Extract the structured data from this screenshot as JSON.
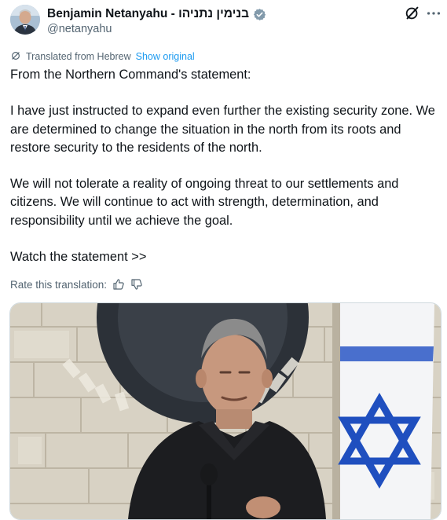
{
  "author": {
    "display_name": "Benjamin Netanyahu - בנימין נתניהו",
    "handle": "@netanyahu",
    "avatar_icon": "profile-photo",
    "verified_icon": "verified-badge-gray"
  },
  "header_actions": {
    "grok_icon": "grok-icon",
    "more_icon": "more-horizontal-icon"
  },
  "translation": {
    "notice": "Translated from Hebrew",
    "show_original": "Show original",
    "rate_label": "Rate this translation:"
  },
  "tweet": {
    "paragraphs": [
      "From the Northern Command's statement:",
      "I have just instructed to expand even further the existing security zone. We are determined to change the situation in the north from its roots and restore security to the residents of the north.",
      "We will not tolerate a reality of ongoing threat to our settlements and citizens. We will continue to act with strength, determination, and responsibility until we achieve the goal.",
      "Watch the statement >>"
    ]
  },
  "media": {
    "type": "video-thumbnail",
    "description_icon": "video-thumbnail-image"
  },
  "colors": {
    "text": "#0f1419",
    "secondary": "#536471",
    "link": "#1d9bf0",
    "flag_blue": "#1f4fbf"
  }
}
